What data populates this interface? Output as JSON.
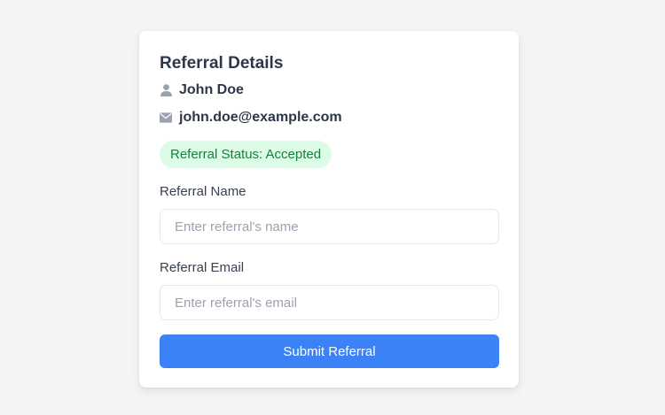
{
  "card": {
    "title": "Referral Details"
  },
  "user": {
    "name": "John Doe",
    "name_icon": "user-icon",
    "email": "john.doe@example.com",
    "email_icon": "envelope-icon"
  },
  "status": {
    "text": "Referral Status: Accepted",
    "bg_color": "#dcfce7",
    "text_color": "#15803d"
  },
  "form": {
    "name_label": "Referral Name",
    "name_placeholder": "Enter referral's name",
    "name_value": "",
    "email_label": "Referral Email",
    "email_placeholder": "Enter referral's email",
    "email_value": "",
    "submit_label": "Submit Referral",
    "submit_color": "#3b82f6"
  }
}
